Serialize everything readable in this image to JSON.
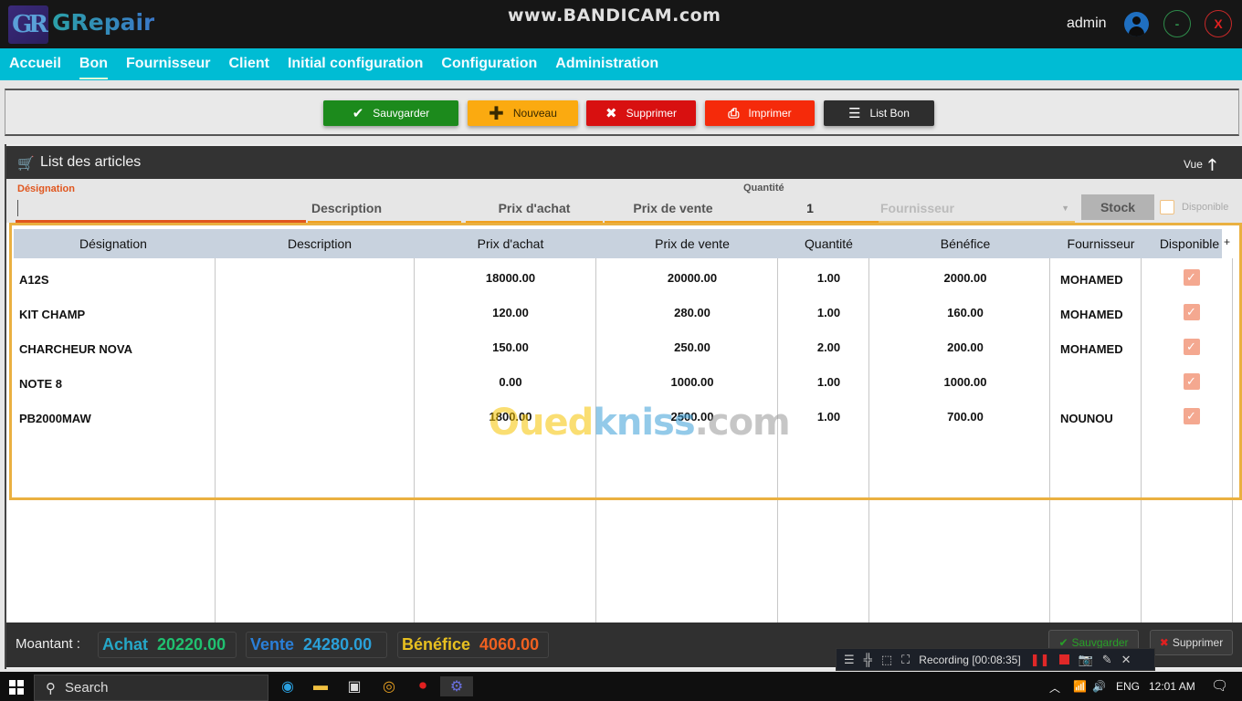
{
  "titlebar": {
    "logo": "GR",
    "app_name": "GRepair",
    "watermark": "www.BANDICAM.com",
    "user": "admin",
    "minimize": "-",
    "close": "X"
  },
  "menu": [
    {
      "label": "Accueil",
      "active": false
    },
    {
      "label": "Bon",
      "active": true
    },
    {
      "label": "Fournisseur",
      "active": false
    },
    {
      "label": "Client",
      "active": false
    },
    {
      "label": "Initial configuration",
      "active": false
    },
    {
      "label": "Configuration",
      "active": false
    },
    {
      "label": "Administration",
      "active": false
    }
  ],
  "toolbar": {
    "save": "Sauvgarder",
    "new": "Nouveau",
    "delete": "Supprimer",
    "print": "Imprimer",
    "list": "List Bon"
  },
  "panel": {
    "title": "List des articles",
    "vue": "Vue"
  },
  "form": {
    "designation_label": "Désignation",
    "designation_value": "",
    "description_placeholder": "Description",
    "prix_achat_placeholder": "Prix d'achat",
    "prix_vente_placeholder": "Prix de vente",
    "quantite_label": "Quantité",
    "quantite_value": "1",
    "fournisseur_placeholder": "Fournisseur",
    "stock_button": "Stock",
    "disponible_label": "Disponible",
    "disponible_checked": false
  },
  "table": {
    "columns": [
      "Désignation",
      "Description",
      "Prix d'achat",
      "Prix de vente",
      "Quantité",
      "Bénéfice",
      "Fournisseur",
      "Disponible"
    ],
    "add_column": "+",
    "rows": [
      {
        "designation": "A12S",
        "description": "",
        "prix_achat": "18000.00",
        "prix_vente": "20000.00",
        "quantite": "1.00",
        "benefice": "2000.00",
        "fournisseur": "MOHAMED",
        "disponible": true
      },
      {
        "designation": "KIT CHAMP",
        "description": "",
        "prix_achat": "120.00",
        "prix_vente": "280.00",
        "quantite": "1.00",
        "benefice": "160.00",
        "fournisseur": "MOHAMED",
        "disponible": true
      },
      {
        "designation": "CHARCHEUR NOVA",
        "description": "",
        "prix_achat": "150.00",
        "prix_vente": "250.00",
        "quantite": "2.00",
        "benefice": "200.00",
        "fournisseur": "MOHAMED",
        "disponible": true
      },
      {
        "designation": "NOTE 8",
        "description": "",
        "prix_achat": "0.00",
        "prix_vente": "1000.00",
        "quantite": "1.00",
        "benefice": "1000.00",
        "fournisseur": "",
        "disponible": true
      },
      {
        "designation": "PB2000MAW",
        "description": "",
        "prix_achat": "1800.00",
        "prix_vente": "2500.00",
        "quantite": "1.00",
        "benefice": "700.00",
        "fournisseur": "NOUNOU",
        "disponible": true
      }
    ]
  },
  "overlay_watermark": {
    "part1": "Oued",
    "part2": "kniss",
    "part3": ".com"
  },
  "footer": {
    "label": "Moantant :",
    "achat_label": "Achat",
    "achat_value": "20220.00",
    "vente_label": "Vente",
    "vente_value": "24280.00",
    "benefice_label": "Bénéfice",
    "benefice_value": "4060.00",
    "save": "Sauvgarder",
    "delete": "Supprimer"
  },
  "recording": {
    "status": "Recording [00:08:35]"
  },
  "taskbar": {
    "search_placeholder": "Search",
    "language": "ENG",
    "time": "12:01 AM"
  },
  "colors": {
    "menu_bg": "#00bcd4",
    "accent_orange": "#eab040",
    "save_green": "#1c8a1c",
    "new_yellow": "#fbaa10",
    "delete_red": "#d81010",
    "print_red": "#f52a0a"
  }
}
